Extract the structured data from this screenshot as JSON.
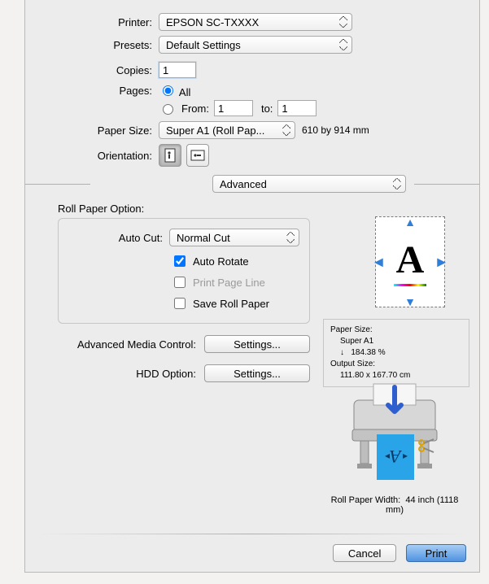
{
  "labels": {
    "printer": "Printer:",
    "presets": "Presets:",
    "copies": "Copies:",
    "pages": "Pages:",
    "all": "All",
    "from": "From:",
    "to": "to:",
    "paper_size": "Paper Size:",
    "orientation": "Orientation:",
    "roll_paper_option": "Roll Paper Option:",
    "auto_cut": "Auto Cut:",
    "auto_rotate": "Auto Rotate",
    "print_page_line": "Print Page Line",
    "save_roll_paper": "Save Roll Paper",
    "adv_media_control": "Advanced Media Control:",
    "hdd_option": "HDD Option:",
    "settings": "Settings...",
    "paper_size_info": "Paper Size:",
    "output_size": "Output Size:",
    "roll_paper_width": "Roll Paper Width:",
    "cancel": "Cancel",
    "print": "Print"
  },
  "values": {
    "printer": "EPSON SC-TXXXX",
    "presets": "Default Settings",
    "copies": "1",
    "page_mode": "all",
    "from": "1",
    "to_val": "1",
    "paper_size": "Super A1 (Roll Pap...",
    "paper_size_dim": "610 by 914 mm",
    "pane": "Advanced",
    "auto_cut": "Normal Cut",
    "auto_rotate": true,
    "print_page_line": false,
    "save_roll_paper": false,
    "preview_glyph": "A",
    "info_paper_size": "Super A1",
    "info_scale": "184.38  %",
    "info_output": "111.80 x 167.70 cm",
    "roll_width": "44 inch (1118 mm)"
  }
}
